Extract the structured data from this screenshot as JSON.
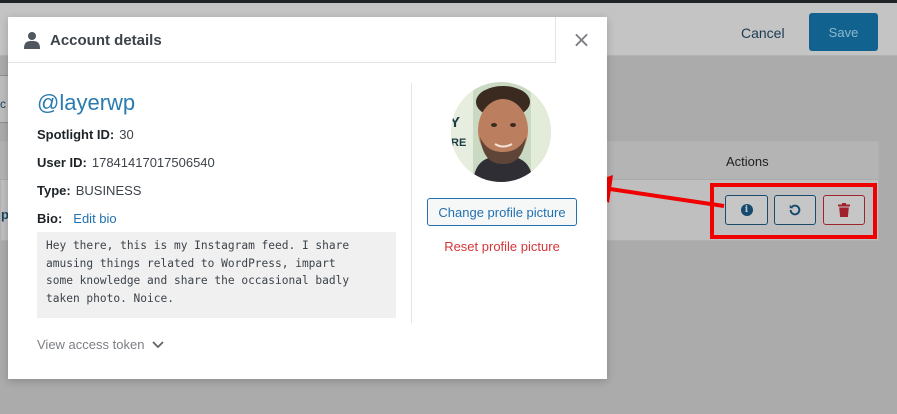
{
  "background": {
    "cancel_label": "Cancel",
    "save_label": "Save",
    "tab_letter": "c",
    "table_header_actions": "Actions",
    "row_letter": "p"
  },
  "modal": {
    "title": "Account details",
    "close_label": "×",
    "username": "@layerwp",
    "fields": [
      {
        "label": "Spotlight ID:",
        "value": "30"
      },
      {
        "label": "User ID:",
        "value": "17841417017506540"
      },
      {
        "label": "Type:",
        "value": "BUSINESS"
      }
    ],
    "bio_label": "Bio:",
    "edit_bio_label": "Edit bio",
    "bio_lines": [
      "Hey there, this is my Instagram feed. I share",
      "amusing things related to WordPress, impart",
      "some knowledge and share the occasional badly",
      "taken photo. Noice."
    ],
    "view_token_label": "View access token",
    "change_picture_label": "Change profile picture",
    "reset_picture_label": "Reset profile picture",
    "avatar_backdrop_text": [
      "Y",
      "RE"
    ]
  },
  "colors": {
    "annotation": "#f00000",
    "link": "#2271b1",
    "danger": "#d63638"
  }
}
